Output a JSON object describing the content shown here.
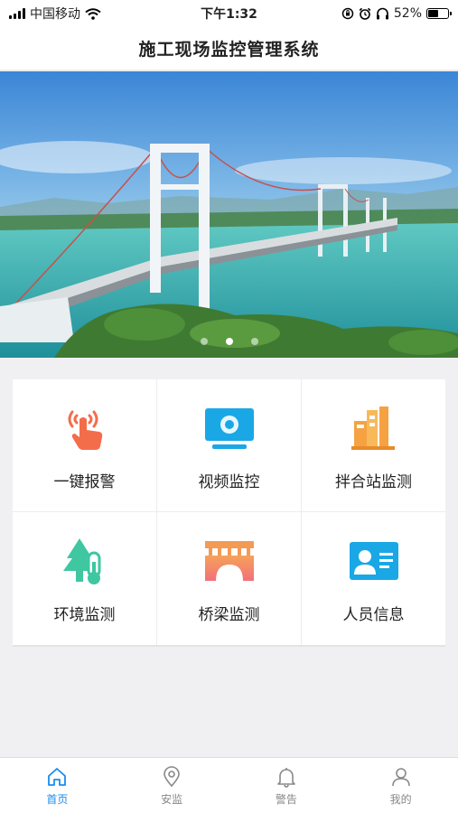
{
  "status_bar": {
    "carrier": "中国移动",
    "time": "下午1:32",
    "battery": "52%",
    "battery_level": 0.52
  },
  "header": {
    "title": "施工现场监控管理系统"
  },
  "banner": {
    "slide_count": 3,
    "active_slide": 1
  },
  "menu": {
    "items": [
      {
        "label": "一键报警",
        "icon": "alarm-hand-icon"
      },
      {
        "label": "视频监控",
        "icon": "video-camera-icon"
      },
      {
        "label": "拌合站监测",
        "icon": "mixing-station-icon"
      },
      {
        "label": "环境监测",
        "icon": "environment-thermometer-icon"
      },
      {
        "label": "桥梁监测",
        "icon": "bridge-icon"
      },
      {
        "label": "人员信息",
        "icon": "id-card-icon"
      }
    ]
  },
  "tabs": {
    "items": [
      {
        "label": "首页",
        "icon": "home-icon",
        "active": true
      },
      {
        "label": "安监",
        "icon": "location-pin-icon",
        "active": false
      },
      {
        "label": "警告",
        "icon": "bell-icon",
        "active": false
      },
      {
        "label": "我的",
        "icon": "user-icon",
        "active": false
      }
    ]
  },
  "colors": {
    "accent": "#1a8cf0",
    "tab_inactive": "#888888"
  }
}
